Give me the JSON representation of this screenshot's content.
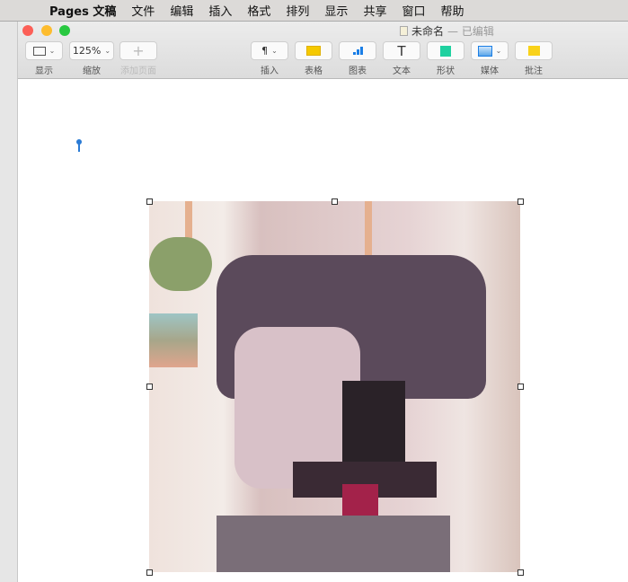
{
  "menubar": {
    "items": [
      "Pages 文稿",
      "文件",
      "编辑",
      "插入",
      "格式",
      "排列",
      "显示",
      "共享",
      "窗口",
      "帮助"
    ]
  },
  "window": {
    "title": "未命名",
    "status": "— 已编辑"
  },
  "toolbar": {
    "view": {
      "label": "显示"
    },
    "zoom": {
      "value": "125%",
      "label": "缩放"
    },
    "add_page": {
      "label": "添加页面"
    },
    "insert": {
      "label": "插入"
    },
    "table": {
      "label": "表格"
    },
    "chart": {
      "label": "图表"
    },
    "text": {
      "label": "文本"
    },
    "shape": {
      "label": "形状"
    },
    "media": {
      "label": "媒体"
    },
    "comment": {
      "label": "批注"
    }
  },
  "colors": {
    "close": "#fc5f57",
    "minimize": "#fdbc2e",
    "zoom": "#28c840",
    "table": "#f5c900",
    "shape": "#1fd1a0",
    "comment": "#f9d21a",
    "chart": "#1a7ee6"
  }
}
